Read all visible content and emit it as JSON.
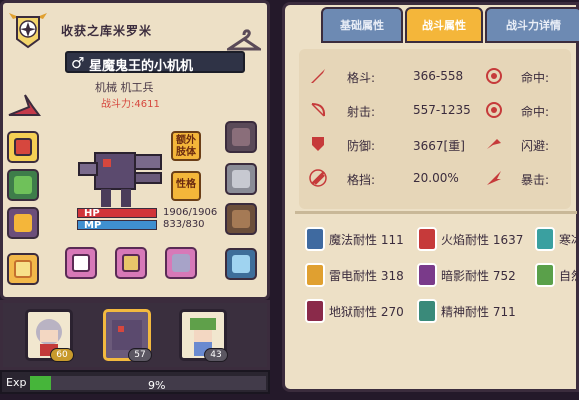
{
  "character": {
    "title": "收获之库米罗米",
    "gender_symbol": "♂",
    "name": "星魔鬼王的小机机",
    "class": "机械 机工兵",
    "combat_power": "战斗力:4611",
    "extra_limb_button": "额外\n肢体",
    "personality_button": "性格",
    "hp_label": "HP",
    "hp_value": "1906/1906",
    "mp_label": "MP",
    "mp_value": "833/830"
  },
  "team": [
    {
      "level": "60"
    },
    {
      "level": "57"
    },
    {
      "level": "43"
    }
  ],
  "exp": {
    "label": "Exp",
    "percent_text": "9%",
    "fill_fraction": 0.09
  },
  "tabs": [
    {
      "label": "基础属性"
    },
    {
      "label": "战斗属性"
    },
    {
      "label": "战斗力详情"
    }
  ],
  "stats": {
    "melee_label": "格斗:",
    "melee_value": "366-558",
    "shoot_label": "射击:",
    "shoot_value": "557-1235",
    "def_label": "防御:",
    "def_value": "3667[重]",
    "block_label": "格挡:",
    "block_value": "20.00%",
    "hit_label": "命中:",
    "hit2_label": "命中:",
    "dodge_label": "闪避:",
    "crit_label": "暴击:"
  },
  "resist": [
    {
      "text": "魔法耐性 111"
    },
    {
      "text": "火焰耐性 1637"
    },
    {
      "text": "寒冰"
    },
    {
      "text": "雷电耐性 318"
    },
    {
      "text": "暗影耐性 752"
    },
    {
      "text": "自然"
    },
    {
      "text": "地狱耐性 270"
    },
    {
      "text": "精神耐性 711"
    }
  ],
  "colors": {
    "accent": "#f4b63a",
    "tab_inactive": "#6d8ab3",
    "hp": "#d1343a",
    "mp": "#3f8fd0",
    "exp": "#46b53a",
    "stat_icon": "#c63a3a"
  }
}
